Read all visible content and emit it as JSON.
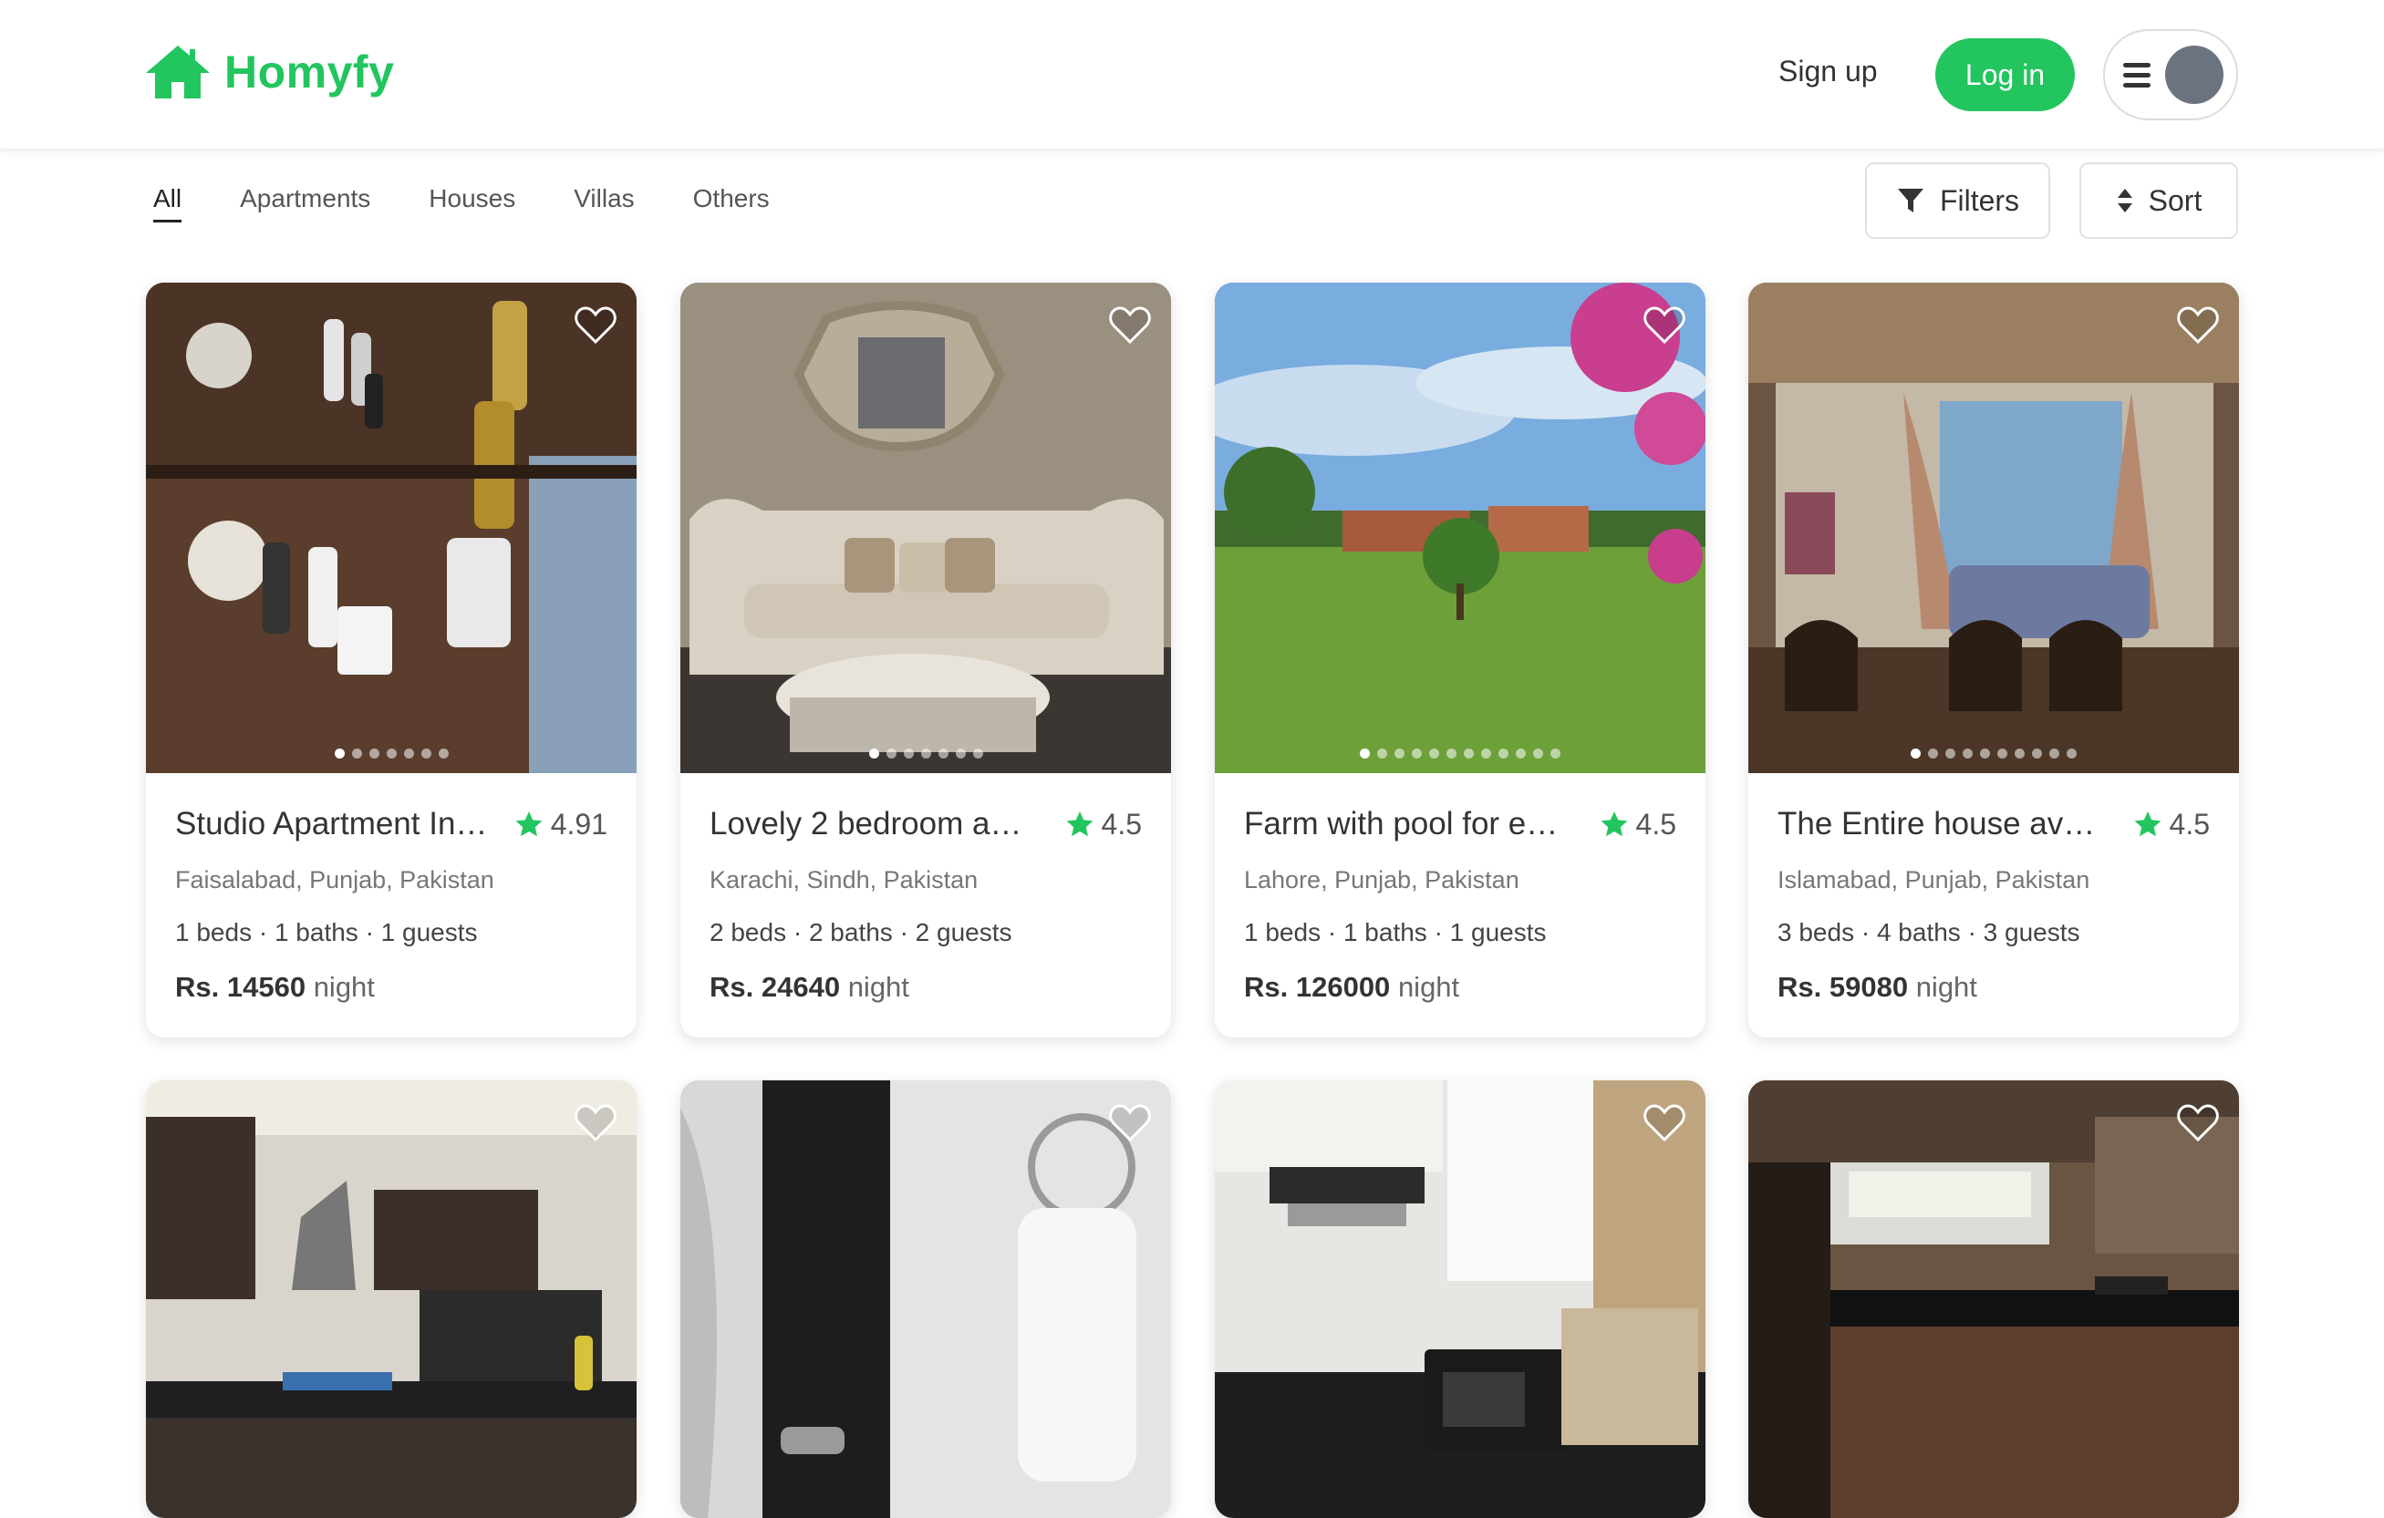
{
  "brand": {
    "name": "Homyfy",
    "color": "#22c55e",
    "icon": "house-icon"
  },
  "nav": {
    "signup_label": "Sign up",
    "login_label": "Log in"
  },
  "categories": [
    "All",
    "Apartments",
    "Houses",
    "Villas",
    "Others"
  ],
  "active_category": "All",
  "toolbar": {
    "filters_label": "Filters",
    "sort_label": "Sort"
  },
  "listings": [
    {
      "title": "Studio Apartment In…",
      "rating": "4.91",
      "location": "Faisalabad, Punjab, Pakistan",
      "details": "1 beds · 1 baths · 1 guests",
      "price": "Rs. 14560",
      "unit": "night",
      "photos": 7,
      "active_photo": 1
    },
    {
      "title": "Lovely 2 bedroom ap…",
      "rating": "4.5",
      "location": "Karachi, Sindh, Pakistan",
      "details": "2 beds · 2 baths · 2 guests",
      "price": "Rs. 24640",
      "unit": "night",
      "photos": 7,
      "active_photo": 1
    },
    {
      "title": "Farm with pool for ev…",
      "rating": "4.5",
      "location": "Lahore, Punjab, Pakistan",
      "details": "1 beds · 1 baths · 1 guests",
      "price": "Rs. 126000",
      "unit": "night",
      "photos": 12,
      "active_photo": 1
    },
    {
      "title": "The Entire house av…",
      "rating": "4.5",
      "location": "Islamabad, Punjab, Pakistan",
      "details": "3 beds · 4 baths · 3 guests",
      "price": "Rs. 59080",
      "unit": "night",
      "photos": 10,
      "active_photo": 1
    },
    {
      "title": "",
      "photos": 0
    },
    {
      "title": "",
      "photos": 0
    },
    {
      "title": "",
      "photos": 0
    },
    {
      "title": "",
      "photos": 0
    }
  ]
}
